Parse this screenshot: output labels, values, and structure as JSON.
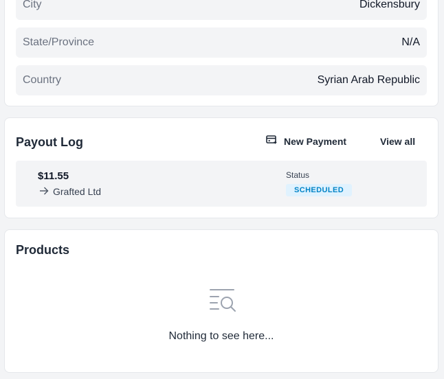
{
  "address": {
    "rows": [
      {
        "label": "City",
        "value": "Dickensbury"
      },
      {
        "label": "State/Province",
        "value": "N/A"
      },
      {
        "label": "Country",
        "value": "Syrian Arab Republic"
      }
    ]
  },
  "payout": {
    "title": "Payout Log",
    "new_payment_label": "New Payment",
    "view_all_label": "View all",
    "entries": [
      {
        "amount": "$11.55",
        "recipient": "Grafted Ltd",
        "status_label": "Status",
        "status": "SCHEDULED"
      }
    ]
  },
  "products": {
    "title": "Products",
    "empty_text": "Nothing to see here..."
  },
  "colors": {
    "page_bg": "#f3f4f6",
    "card_bg": "#ffffff",
    "status_badge_bg": "#e0f2fe",
    "status_badge_text": "#0284c7"
  },
  "icons": {
    "new_payment": "payment-card-icon",
    "recipient": "arrow-right-icon",
    "empty": "search-list-icon"
  }
}
